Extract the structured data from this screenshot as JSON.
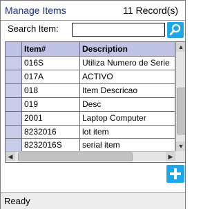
{
  "header": {
    "title": "Manage Items",
    "record_count": "11  Record(s)"
  },
  "search": {
    "label": "Search Item:",
    "value": "",
    "button_icon": "search-icon"
  },
  "grid": {
    "columns": [
      "Item#",
      "Description"
    ],
    "rows": [
      {
        "item": "016S",
        "description": "Utiliza Numero de Serie"
      },
      {
        "item": "017A",
        "description": "ACTIVO"
      },
      {
        "item": "018",
        "description": "Item Descricao"
      },
      {
        "item": "019",
        "description": "Desc"
      },
      {
        "item": "2001",
        "description": "Laptop Computer"
      },
      {
        "item": "8232016",
        "description": "lot item"
      },
      {
        "item": "8232016S",
        "description": "serial item"
      }
    ]
  },
  "add_button": {
    "icon": "plus-icon"
  },
  "status": {
    "text": "Ready"
  },
  "colors": {
    "accent": "#1ea7e8",
    "header_bg": "#bfc4e6",
    "title": "#1a2a8a"
  }
}
